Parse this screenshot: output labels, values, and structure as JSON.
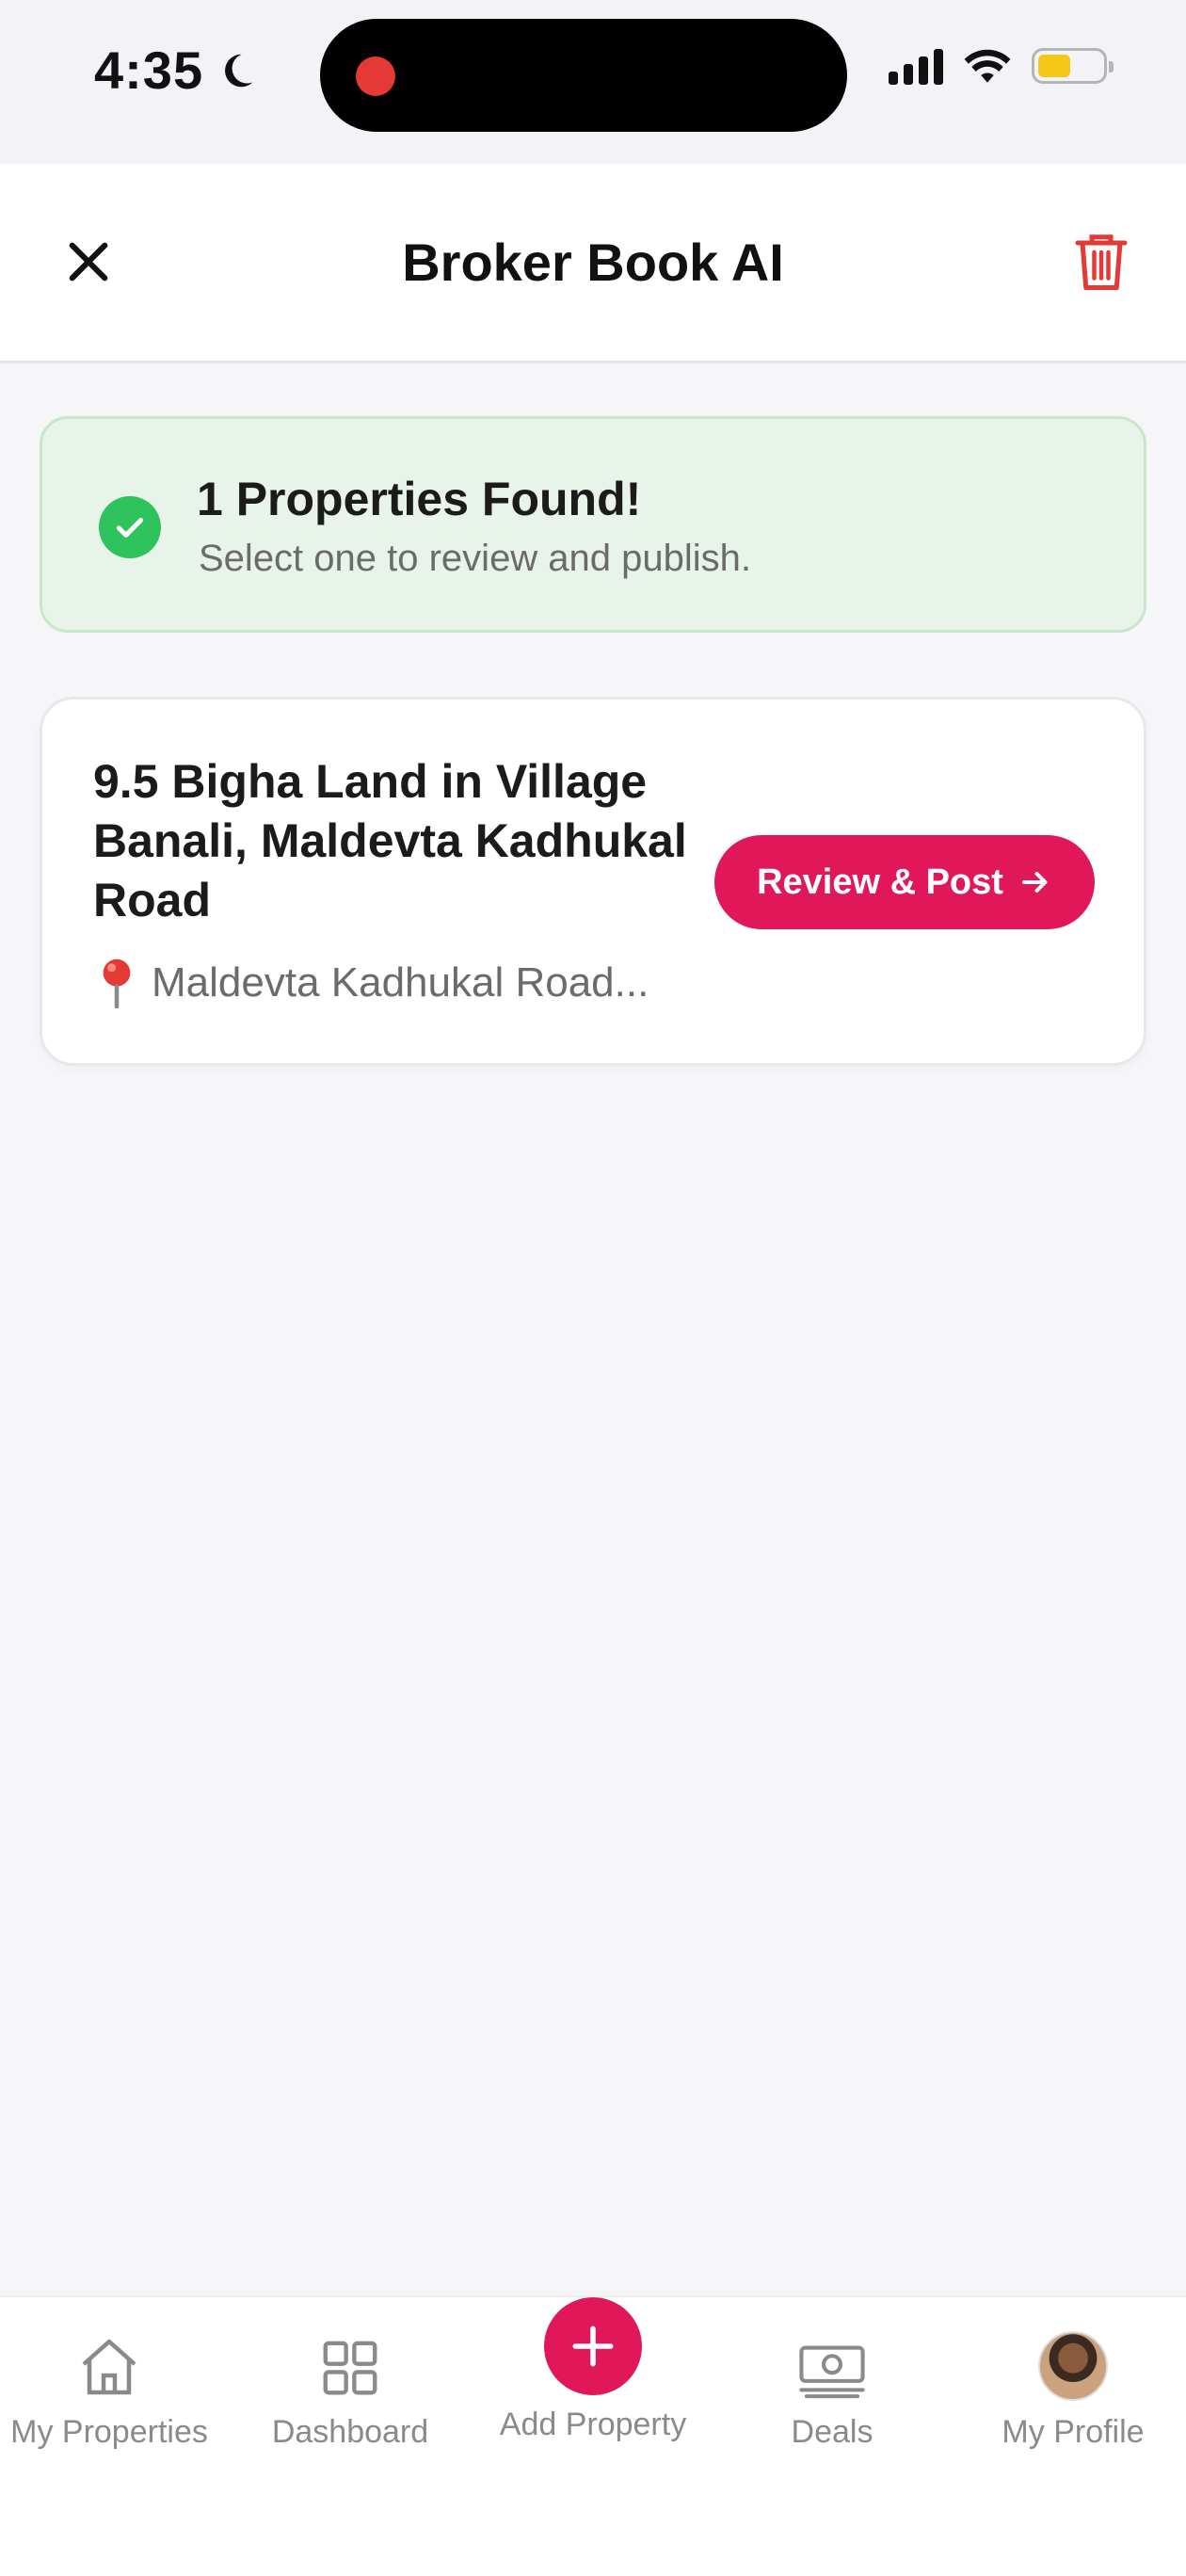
{
  "status_bar": {
    "time": "4:35"
  },
  "header": {
    "title": "Broker Book AI",
    "close_icon": "close-icon",
    "delete_icon": "trash-icon"
  },
  "banner": {
    "title": "1 Properties Found!",
    "subtitle": "Select one to review and publish."
  },
  "properties": [
    {
      "title": "9.5 Bigha Land in Village Banali, Maldevta Kadhukal Road",
      "location": "Maldevta Kadhukal Road...",
      "action_label": "Review & Post"
    }
  ],
  "bottom_nav": {
    "items": [
      {
        "label": "My Properties",
        "icon": "home-icon"
      },
      {
        "label": "Dashboard",
        "icon": "grid-icon"
      },
      {
        "label": "Add Property",
        "icon": "plus-icon"
      },
      {
        "label": "Deals",
        "icon": "cash-icon"
      },
      {
        "label": "My Profile",
        "icon": "avatar"
      }
    ]
  },
  "colors": {
    "accent": "#e0185a",
    "success": "#2ec35c",
    "banner_bg": "#e8f4ea",
    "danger": "#e53935"
  }
}
